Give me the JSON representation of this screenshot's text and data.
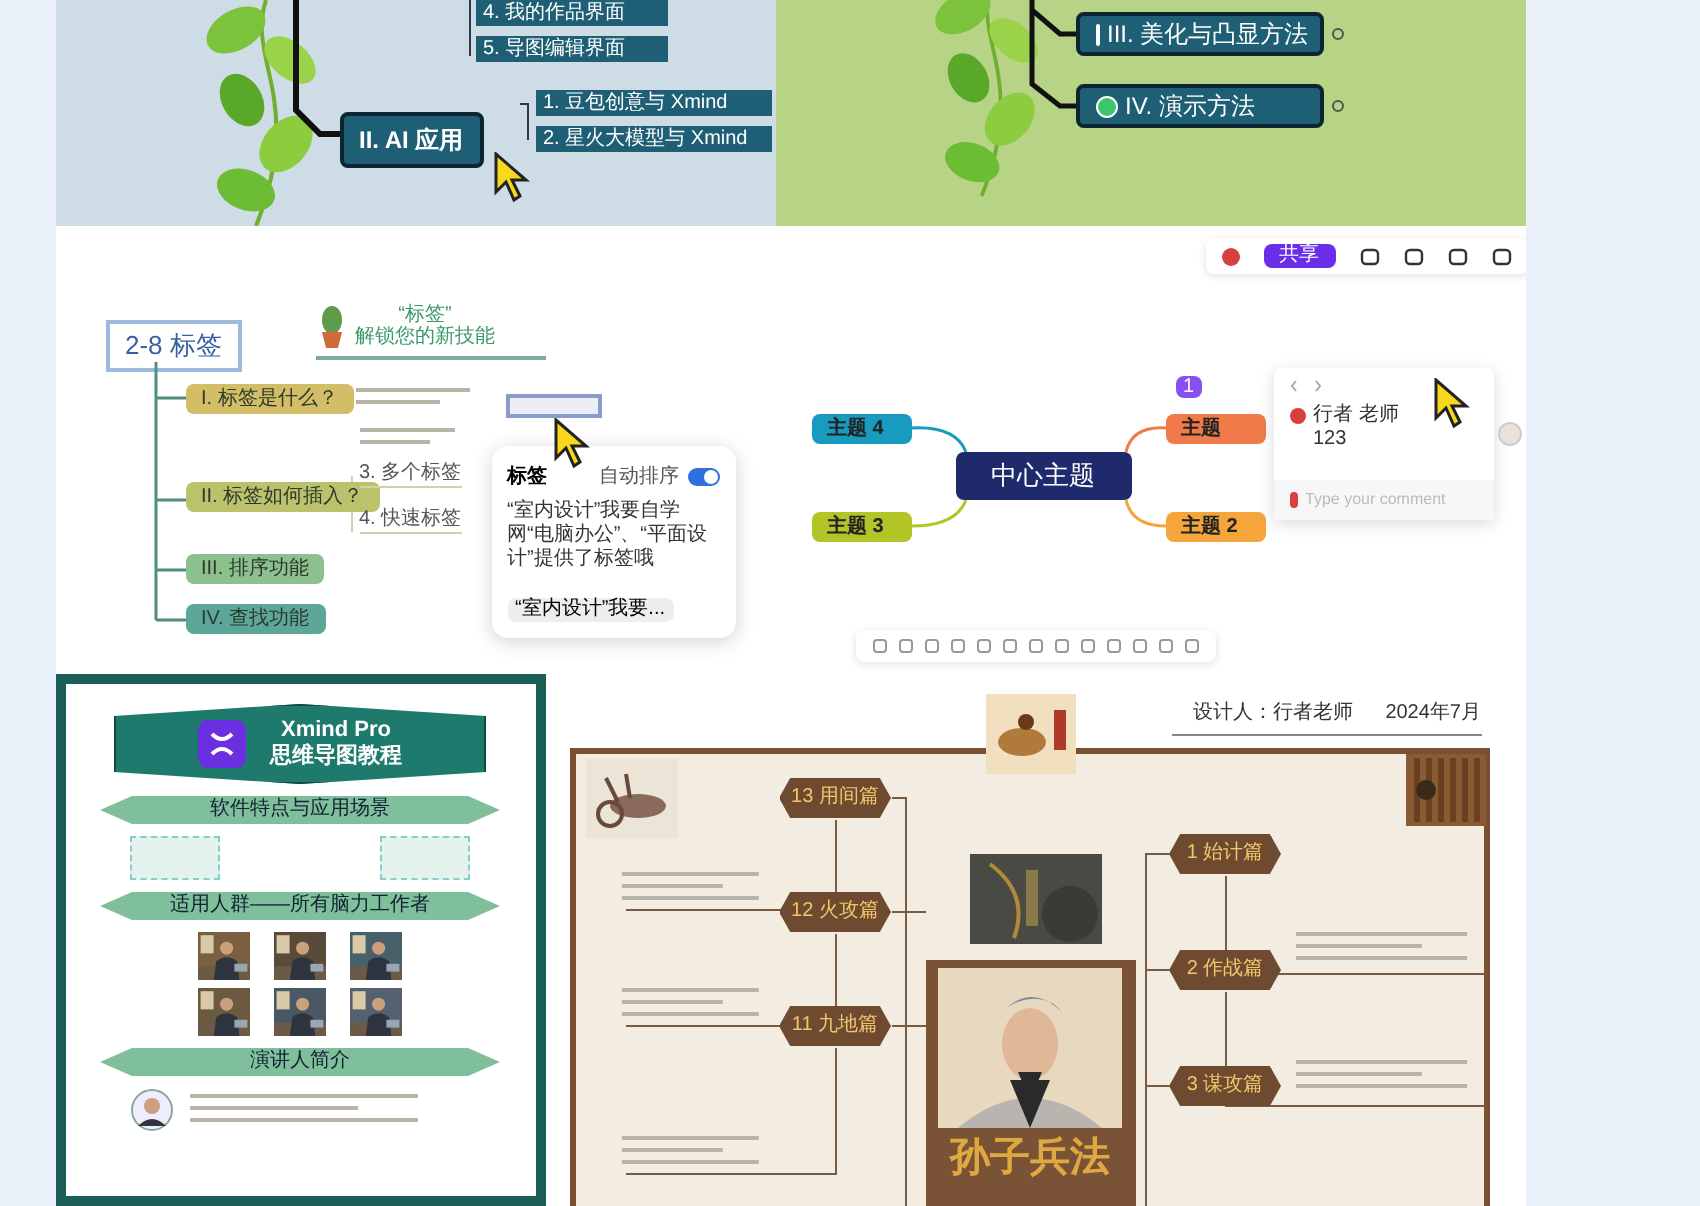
{
  "outline_map": {
    "upper_subtopics": [
      "4. 我的作品界面",
      "5. 导图编辑界面"
    ],
    "branch": "II. AI 应用",
    "subtopics": [
      "1. 豆包创意与 Xmind",
      "2. 星火大模型与 Xmind"
    ]
  },
  "green_map": {
    "branches": [
      "III. 美化与凸显方法",
      "IV. 演示方法"
    ]
  },
  "tag_map": {
    "root": "2-8 标签",
    "header_quote": "“标签”",
    "header_subtitle": "解锁您的新技能",
    "branches": [
      {
        "label": "I. 标签是什么？",
        "color": "#d3bd66"
      },
      {
        "label": "II. 标签如何插入？",
        "color": "#bcc26c"
      },
      {
        "label": "III. 排序功能",
        "color": "#8cc08e"
      },
      {
        "label": "IV. 查找功能",
        "color": "#5da79a"
      }
    ],
    "details": [
      "3. 多个标签",
      "4. 快速标签"
    ],
    "popup": {
      "title": "标签",
      "toggle_label": "自动排序",
      "toggle_on": true,
      "text": "“室内设计”我要自学网“电脑办公”、“平面设计”提供了标签哦",
      "chip": "“室内设计”我要..."
    }
  },
  "cloud_map": {
    "share": "共享",
    "center": "中心主题",
    "topics": [
      {
        "label": "主题 4",
        "color": "#179bbf"
      },
      {
        "label": "主题 3",
        "color": "#b3c426"
      },
      {
        "label": "主题",
        "color": "#f07a4a"
      },
      {
        "label": "主题 2",
        "color": "#f5a53a"
      }
    ],
    "comment": {
      "count": "1",
      "author": "行者 老师",
      "body": "123",
      "placeholder": "Type your comment"
    }
  },
  "poster": {
    "title": "Xmind Pro",
    "subtitle": "思维导图教程",
    "sections": [
      "软件特点与应用场景",
      "适用人群——所有脑力工作者",
      "演讲人简介"
    ]
  },
  "art_map": {
    "designer": "设计人：行者老师",
    "date": "2024年7月",
    "center": "孙子兵法",
    "left_chapters": [
      "13 用间篇",
      "12 火攻篇",
      "11 九地篇"
    ],
    "right_chapters": [
      "1 始计篇",
      "2 作战篇",
      "3 谋攻篇"
    ]
  }
}
